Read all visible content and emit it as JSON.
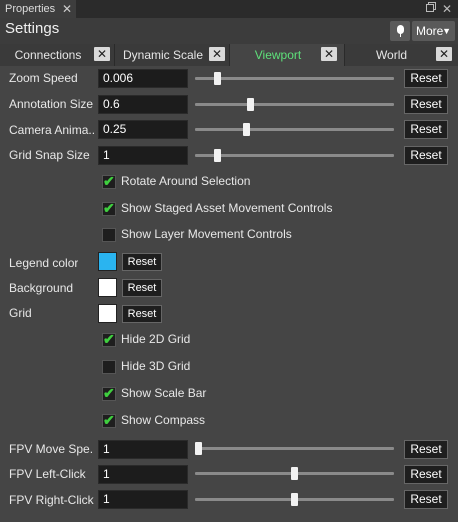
{
  "topbar": {
    "tab_label": "Properties",
    "tab_close": "✕",
    "restore_icon": "restore-icon",
    "close_icon": "✕"
  },
  "header": {
    "title": "Settings",
    "more_label": "More",
    "more_caret": "▼"
  },
  "tabs": [
    {
      "label": "Connections",
      "close": "✕"
    },
    {
      "label": "Dynamic Scale",
      "close": "✕"
    },
    {
      "label": "Viewport",
      "close": "✕",
      "active": true
    },
    {
      "label": "World",
      "close": "✕"
    }
  ],
  "rows": {
    "zoom_speed": {
      "label": "Zoom Speed",
      "value": "0.006",
      "slider": 0.1,
      "reset": "Reset"
    },
    "annotation_size": {
      "label": "Annotation Size",
      "value": "0.6",
      "slider": 0.27,
      "reset": "Reset"
    },
    "camera_animation": {
      "label": "Camera Anima...",
      "value": "0.25",
      "slider": 0.25,
      "reset": "Reset"
    },
    "grid_snap": {
      "label": "Grid Snap Size",
      "value": "1",
      "slider": 0.1,
      "reset": "Reset"
    },
    "fpv_move_speed": {
      "label": "FPV Move Spe...",
      "value": "1",
      "slider": 0.0,
      "reset": "Reset"
    },
    "fpv_left_click": {
      "label": "FPV Left-Click",
      "value": "1",
      "slider": 0.5,
      "reset": "Reset"
    },
    "fpv_right_click": {
      "label": "FPV Right-Click",
      "value": "1",
      "slider": 0.5,
      "reset": "Reset"
    }
  },
  "checks": {
    "rotate_around_selection": {
      "label": "Rotate Around Selection",
      "checked": true
    },
    "show_staged_asset": {
      "label": "Show Staged Asset Movement Controls",
      "checked": true
    },
    "show_layer_movement": {
      "label": "Show Layer Movement Controls",
      "checked": false
    },
    "hide_2d_grid": {
      "label": "Hide 2D Grid",
      "checked": true
    },
    "hide_3d_grid": {
      "label": "Hide 3D Grid",
      "checked": false
    },
    "show_scale_bar": {
      "label": "Show Scale Bar",
      "checked": true
    },
    "show_compass": {
      "label": "Show Compass",
      "checked": true
    }
  },
  "check_mark": "✔",
  "colors": {
    "legend": {
      "label": "Legend color",
      "color": "#2ab4f0",
      "reset": "Reset"
    },
    "background": {
      "label": "Background",
      "color": "#ffffff",
      "reset": "Reset"
    },
    "grid": {
      "label": "Grid",
      "color": "#ffffff",
      "reset": "Reset"
    }
  }
}
